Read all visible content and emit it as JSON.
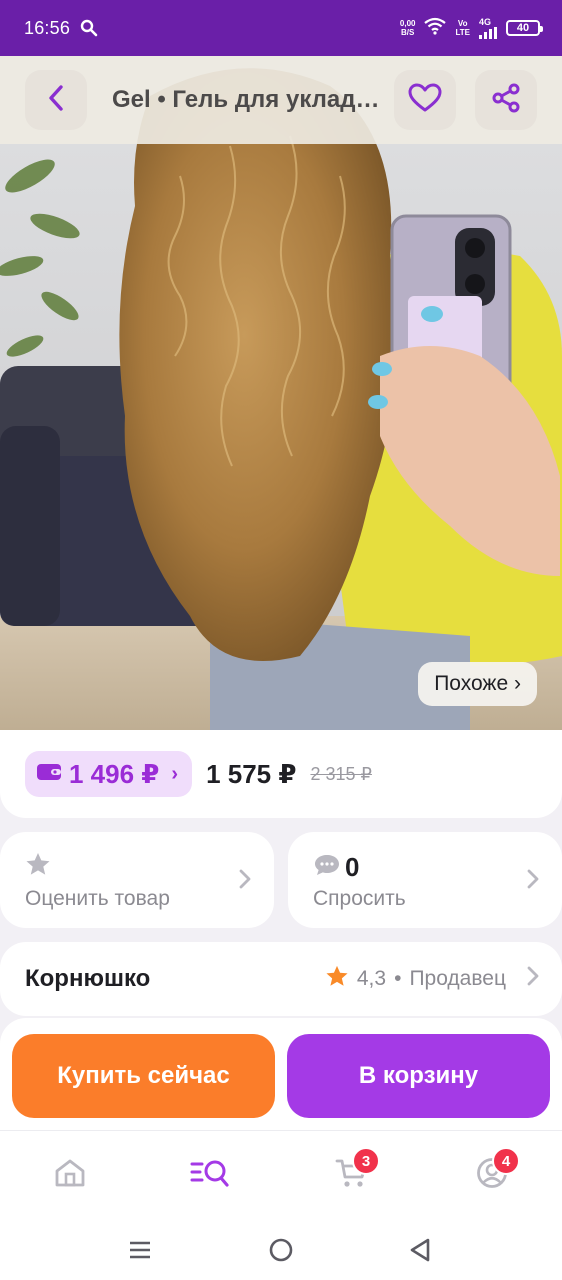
{
  "status_bar": {
    "time": "16:56",
    "net_speed_value": "0,00",
    "net_speed_unit": "B/S",
    "volte_top": "Vo",
    "volte_bottom": "LTE",
    "network": "4G",
    "battery": "40",
    "bg_color": "#6a1fa8"
  },
  "header": {
    "title": "Gel • Гель для укладки волос",
    "back_icon": "chevron-left-icon",
    "favorite_icon": "heart-icon",
    "share_icon": "share-icon"
  },
  "photo": {
    "similar_label": "Похоже ›"
  },
  "price": {
    "wallet_price": "1 496 ₽",
    "current_price": "1 575 ₽",
    "old_price": "2 315 ₽",
    "accent": "#9a2cd6"
  },
  "rate_card": {
    "label": "Оценить товар",
    "icon": "star-icon"
  },
  "ask_card": {
    "count": "0",
    "label": "Спросить",
    "icon": "chat-bubble-icon"
  },
  "seller": {
    "name": "Корнюшко",
    "rating": "4,3",
    "separator": "•",
    "role": "Продавец",
    "star_color": "#f98a28"
  },
  "actions": {
    "buy_now": "Купить сейчас",
    "add_to_cart": "В корзину",
    "buy_color": "#fb7d2a",
    "cart_color": "#a43ae6"
  },
  "bottom_nav": {
    "items": [
      {
        "name": "home",
        "icon": "home-icon"
      },
      {
        "name": "catalog",
        "icon": "catalog-search-icon"
      },
      {
        "name": "cart",
        "icon": "cart-icon",
        "badge": "3"
      },
      {
        "name": "profile",
        "icon": "profile-icon",
        "badge": "4"
      }
    ]
  },
  "system_nav": {
    "items": [
      "menu-icon",
      "home-circle-icon",
      "back-triangle-icon"
    ]
  }
}
